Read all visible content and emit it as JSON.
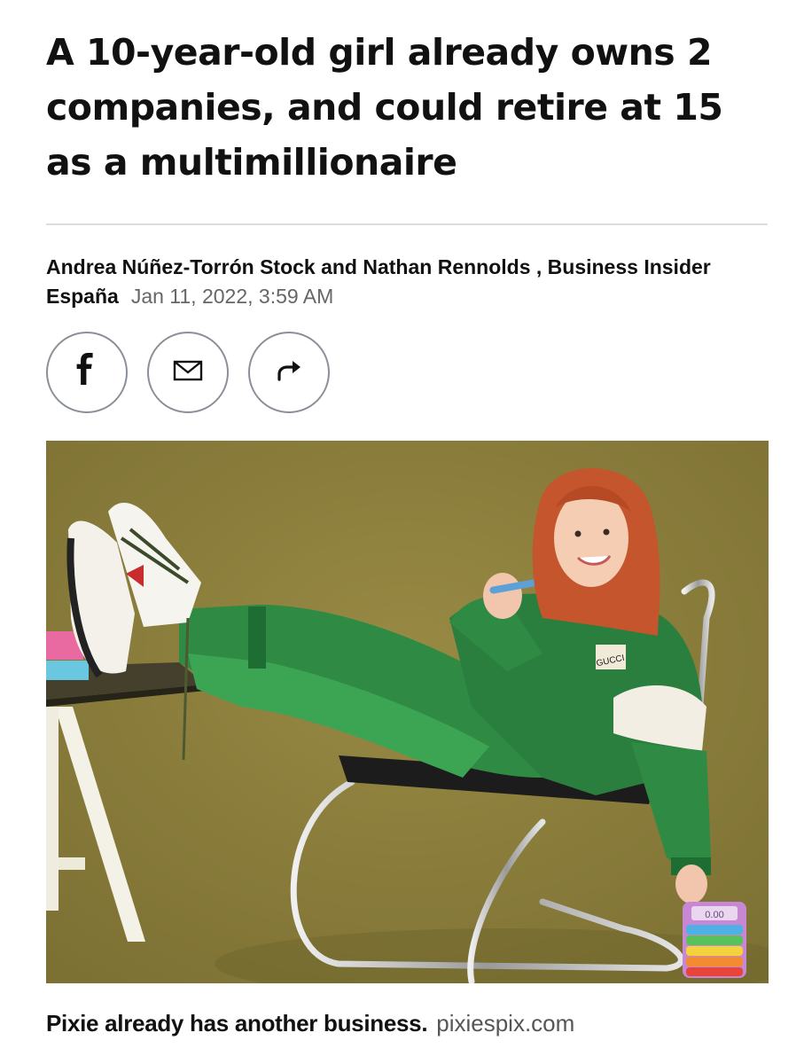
{
  "article": {
    "headline": "A 10-year-old girl already owns 2 companies, and could retire at 15 as a multimillionaire",
    "authors": "Andrea Núñez-Torrón Stock and Nathan Rennolds , Business Insider España",
    "date": "Jan 11, 2022, 3:59 AM"
  },
  "share": [
    {
      "icon": "facebook-icon",
      "label": "f"
    },
    {
      "icon": "mail-icon"
    },
    {
      "icon": "share-arrow-icon"
    }
  ],
  "photo": {
    "badge_text": "GUCCI",
    "calculator_display": "0.00",
    "colors": {
      "background": "#8a7d3b",
      "tracksuit": "#2f8a44",
      "hair": "#c4552c"
    }
  },
  "caption": {
    "text": "Pixie already has another business.",
    "credit": "pixiespix.com"
  },
  "colors": {
    "text": "#111111",
    "muted": "#666666",
    "rule": "#dcdcdc",
    "button_border": "#8a8f98"
  }
}
